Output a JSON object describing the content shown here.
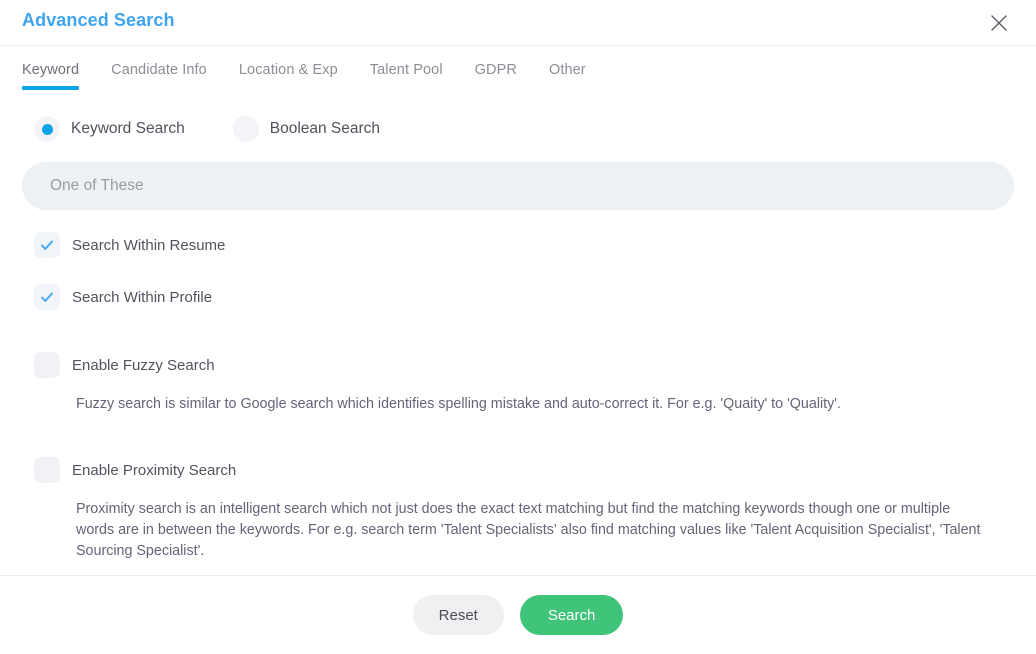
{
  "header": {
    "title": "Advanced Search",
    "close_icon": "close-icon"
  },
  "tabs": [
    {
      "label": "Keyword",
      "active": true
    },
    {
      "label": "Candidate Info",
      "active": false
    },
    {
      "label": "Location & Exp",
      "active": false
    },
    {
      "label": "Talent Pool",
      "active": false
    },
    {
      "label": "GDPR",
      "active": false
    },
    {
      "label": "Other",
      "active": false
    }
  ],
  "search_mode": {
    "options": [
      {
        "label": "Keyword Search",
        "selected": true
      },
      {
        "label": "Boolean Search",
        "selected": false
      }
    ]
  },
  "keyword_input": {
    "value": "",
    "placeholder": "One of These"
  },
  "checkboxes": [
    {
      "label": "Search Within Resume",
      "checked": true
    },
    {
      "label": "Search Within Profile",
      "checked": true
    },
    {
      "label": "Enable Fuzzy Search",
      "checked": false
    },
    {
      "label": "Enable Proximity Search",
      "checked": false
    }
  ],
  "descriptions": {
    "fuzzy": "Fuzzy search is similar to Google search which identifies spelling mistake and auto-correct it. For e.g. 'Quaity' to 'Quality'.",
    "proximity": "Proximity search is an intelligent search which not just does the exact text matching but find the matching keywords though one or multiple words are in between the keywords. For e.g. search term 'Talent Specialists' also find matching values like 'Talent Acquisition Specialist', 'Talent Sourcing Specialist'."
  },
  "footer": {
    "reset_label": "Reset",
    "search_label": "Search"
  },
  "colors": {
    "title_blue": "#3fa4f0",
    "tab_underline": "#0fa3ea",
    "radio_accent": "#0fa3ea",
    "check_accent": "#4aa8f0",
    "search_button": "#40c479",
    "reset_button": "#eff0f2",
    "input_background": "#eef1f4"
  }
}
